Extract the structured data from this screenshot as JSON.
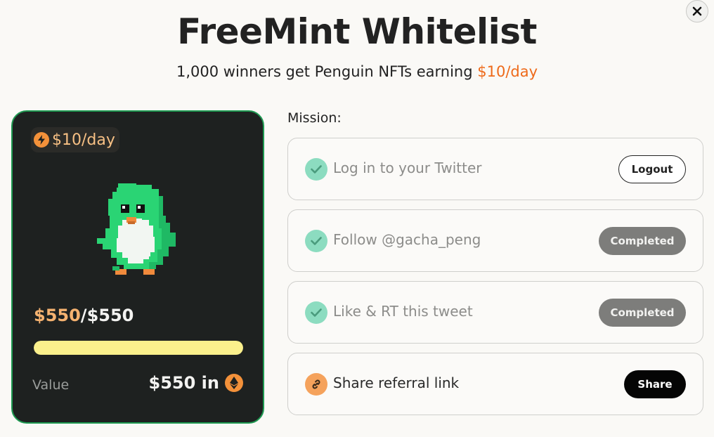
{
  "header": {
    "title": "FreeMint Whitelist",
    "subtitle_prefix": "1,000 winners get Penguin NFTs earning ",
    "subtitle_accent": "$10/day"
  },
  "card": {
    "badge": "$10/day",
    "progress_current": "$550",
    "progress_total": "/$550",
    "progress_fraction": 1.0,
    "value_label": "Value",
    "value_amount": "$550 in"
  },
  "missions": {
    "heading": "Mission:",
    "items": [
      {
        "label": "Log in to your Twitter",
        "status": "done",
        "button": "Logout"
      },
      {
        "label": "Follow @gacha_peng",
        "status": "done",
        "button": "Completed"
      },
      {
        "label": "Like & RT this tweet",
        "status": "done",
        "button": "Completed"
      },
      {
        "label": "Share referral link",
        "status": "todo",
        "button": "Share"
      }
    ]
  },
  "colors": {
    "accent": "#ee6a1a",
    "card_border": "#1f9a52",
    "progress_fill": "#fbf08c",
    "check_bg": "#8cdcc0",
    "link_bg": "#f5a25c"
  }
}
